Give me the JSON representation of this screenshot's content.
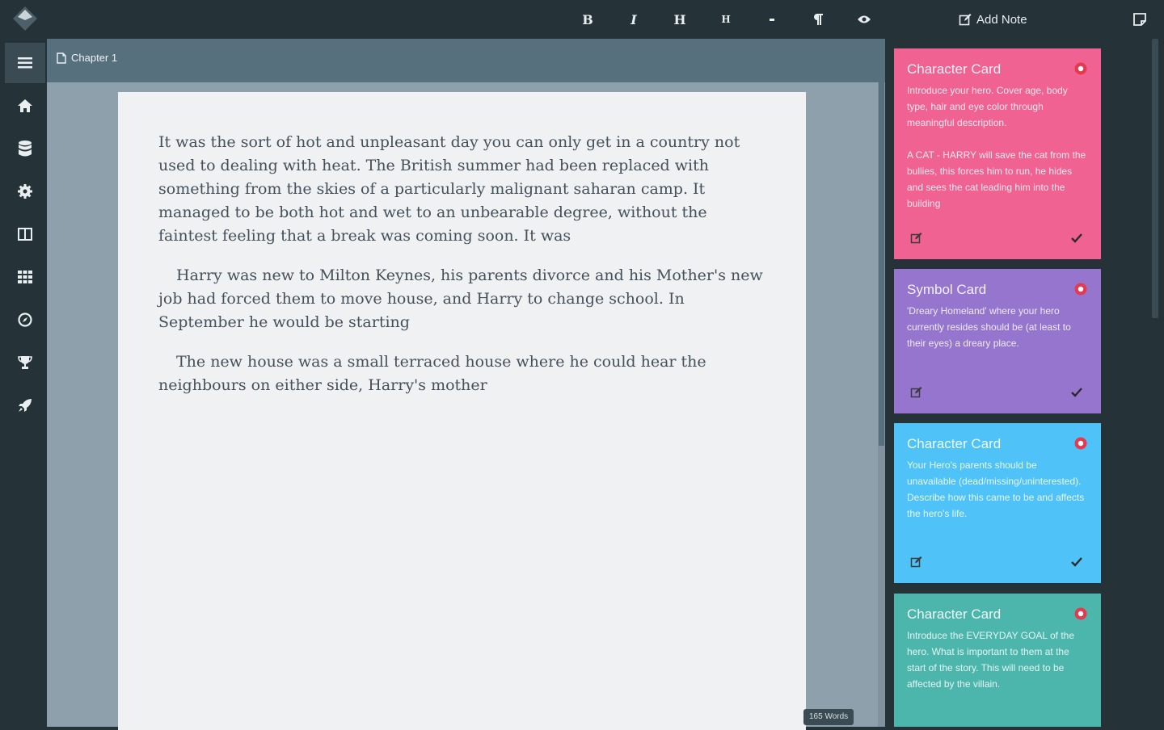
{
  "toolbar": {
    "bold_label": "B",
    "italic_label": "I",
    "heading_label": "H",
    "heading_small_label": "H",
    "add_note_label": "Add Note"
  },
  "sidebar": {
    "items": [
      {
        "icon": "menu-icon"
      },
      {
        "icon": "home-icon"
      },
      {
        "icon": "database-icon"
      },
      {
        "icon": "cog-icon"
      },
      {
        "icon": "columns-icon"
      },
      {
        "icon": "grid-icon"
      },
      {
        "icon": "compass-icon"
      },
      {
        "icon": "trophy-icon"
      },
      {
        "icon": "rocket-icon"
      }
    ]
  },
  "editor": {
    "tab_label": "Chapter 1",
    "word_count": "165 Words",
    "paragraphs": [
      "It was the sort of hot and unpleasant day you can only get in a country not used to dealing with heat. The British summer had been replaced with something from the skies of a particularly malignant saharan camp. It managed to be both hot and wet to an unbearable degree, without the faintest feeling that a break was coming soon. It was",
      "Harry was new to Milton Keynes, his parents divorce and his Mother's new job had forced them to move house, and Harry to change school. In September he would be starting",
      "The new house was a small terraced house where he could hear the neighbours on either side, Harry's mother"
    ]
  },
  "notes": [
    {
      "title": "Character Card",
      "text": "Introduce your hero. Cover age, body type, hair and eye color through meaningful description.\n\nA CAT - HARRY will save the cat from the bullies, this forces him to run, he hides and sees the cat leading him into the building",
      "color": "#f06292"
    },
    {
      "title": "Symbol Card",
      "text": "'Dreary Homeland' where your hero currently resides should be (at least to their eyes) a dreary place.",
      "color": "#9575cd"
    },
    {
      "title": "Character Card",
      "text": "Your Hero's parents should be unavailable (dead/missing/uninterested). Describe how this came to be and affects the hero's life.",
      "color": "#4fc3f7"
    },
    {
      "title": "Character Card",
      "text": "Introduce the EVERYDAY GOAL of the hero. What is important to them at the start of the story. This will need to be affected by the villain.",
      "color": "#4db6ac"
    }
  ],
  "colors": {
    "background": "#253238",
    "tabbar": "#56707e",
    "editor_bg": "#8ea0ab",
    "page": "#eff1f3",
    "close_red": "#e53950"
  }
}
